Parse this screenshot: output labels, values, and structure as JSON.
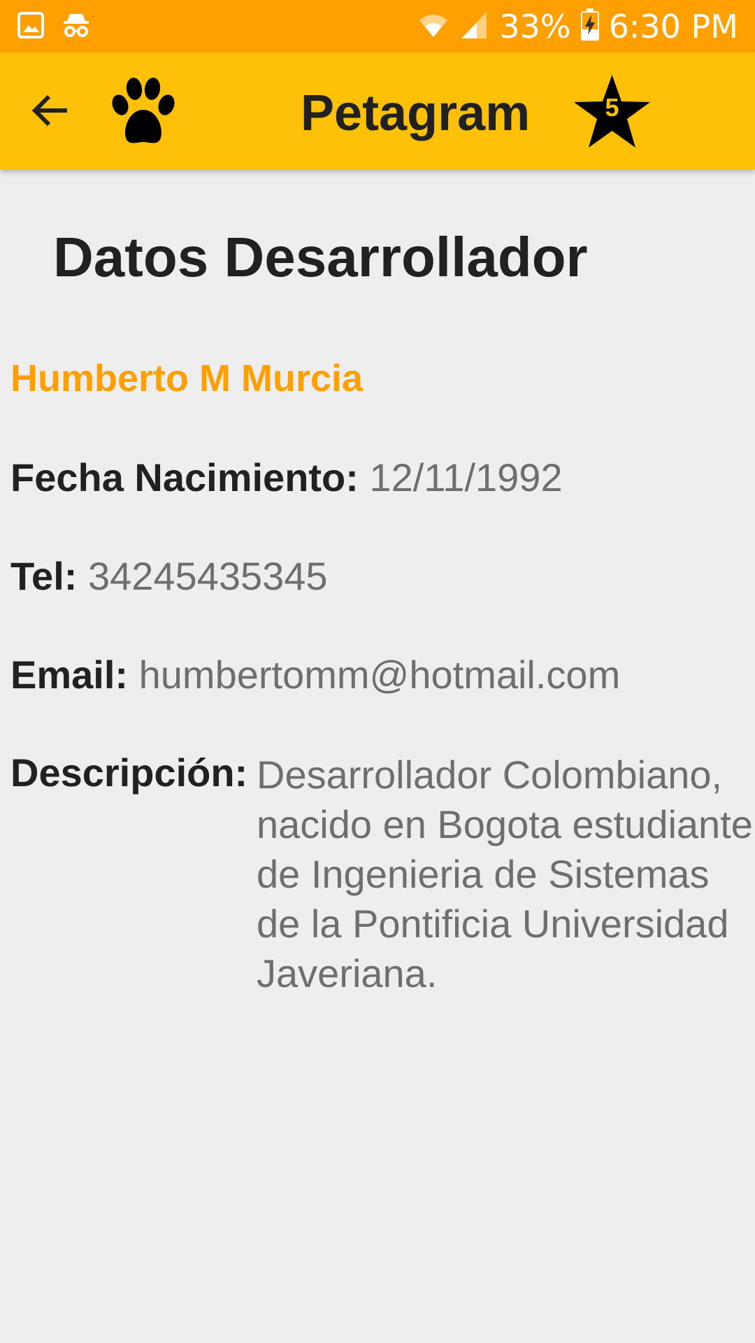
{
  "status_bar": {
    "battery": "33%",
    "time": "6:30 PM",
    "icons": [
      "gallery-icon",
      "incognito-icon",
      "wifi-icon",
      "signal-icon",
      "battery-charging-icon"
    ]
  },
  "app_bar": {
    "title": "Petagram",
    "back_icon": "arrow-back-icon",
    "logo_icon": "paw-icon",
    "favorites_icon": "star-icon",
    "favorites_count": "5"
  },
  "page": {
    "title": "Datos Desarrollador",
    "name": "Humberto M Murcia",
    "birth_label": "Fecha Nacimiento:",
    "birth_value": "12/11/1992",
    "tel_label": "Tel:",
    "tel_value": "34245435345",
    "email_label": "Email:",
    "email_value": "humbertomm@hotmail.com",
    "desc_label": "Descripción:",
    "desc_value": "Desarrollador Colombiano, nacido en Bogota estudiante de Ingenieria de Sistemas de la Pontificia Universidad Javeriana."
  },
  "colors": {
    "status_bar": "#ffa000",
    "app_bar": "#ffc107",
    "accent": "#ffa000",
    "background": "#eeeeee"
  }
}
